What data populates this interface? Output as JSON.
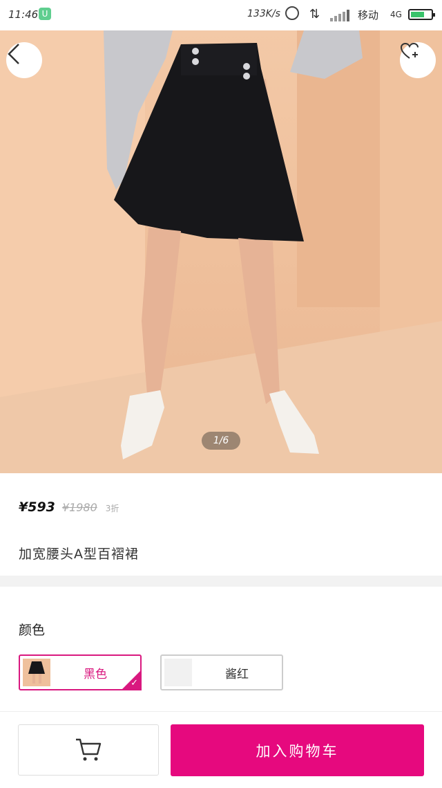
{
  "status_bar": {
    "time": "11:46",
    "speed": "133K/s",
    "carrier": "移动",
    "network": "4G"
  },
  "gallery": {
    "page_indicator": "1/6"
  },
  "product": {
    "price": "¥593",
    "original_price": "¥1980",
    "discount": "3折",
    "title": "加宽腰头A型百褶裙"
  },
  "options": {
    "color_label": "颜色",
    "colors": [
      {
        "label": "黑色",
        "selected": true
      },
      {
        "label": "酱红",
        "selected": false
      }
    ]
  },
  "actions": {
    "add_to_cart": "加入购物车"
  },
  "colors": {
    "accent": "#e6097e",
    "selected_border": "#d9187f"
  }
}
